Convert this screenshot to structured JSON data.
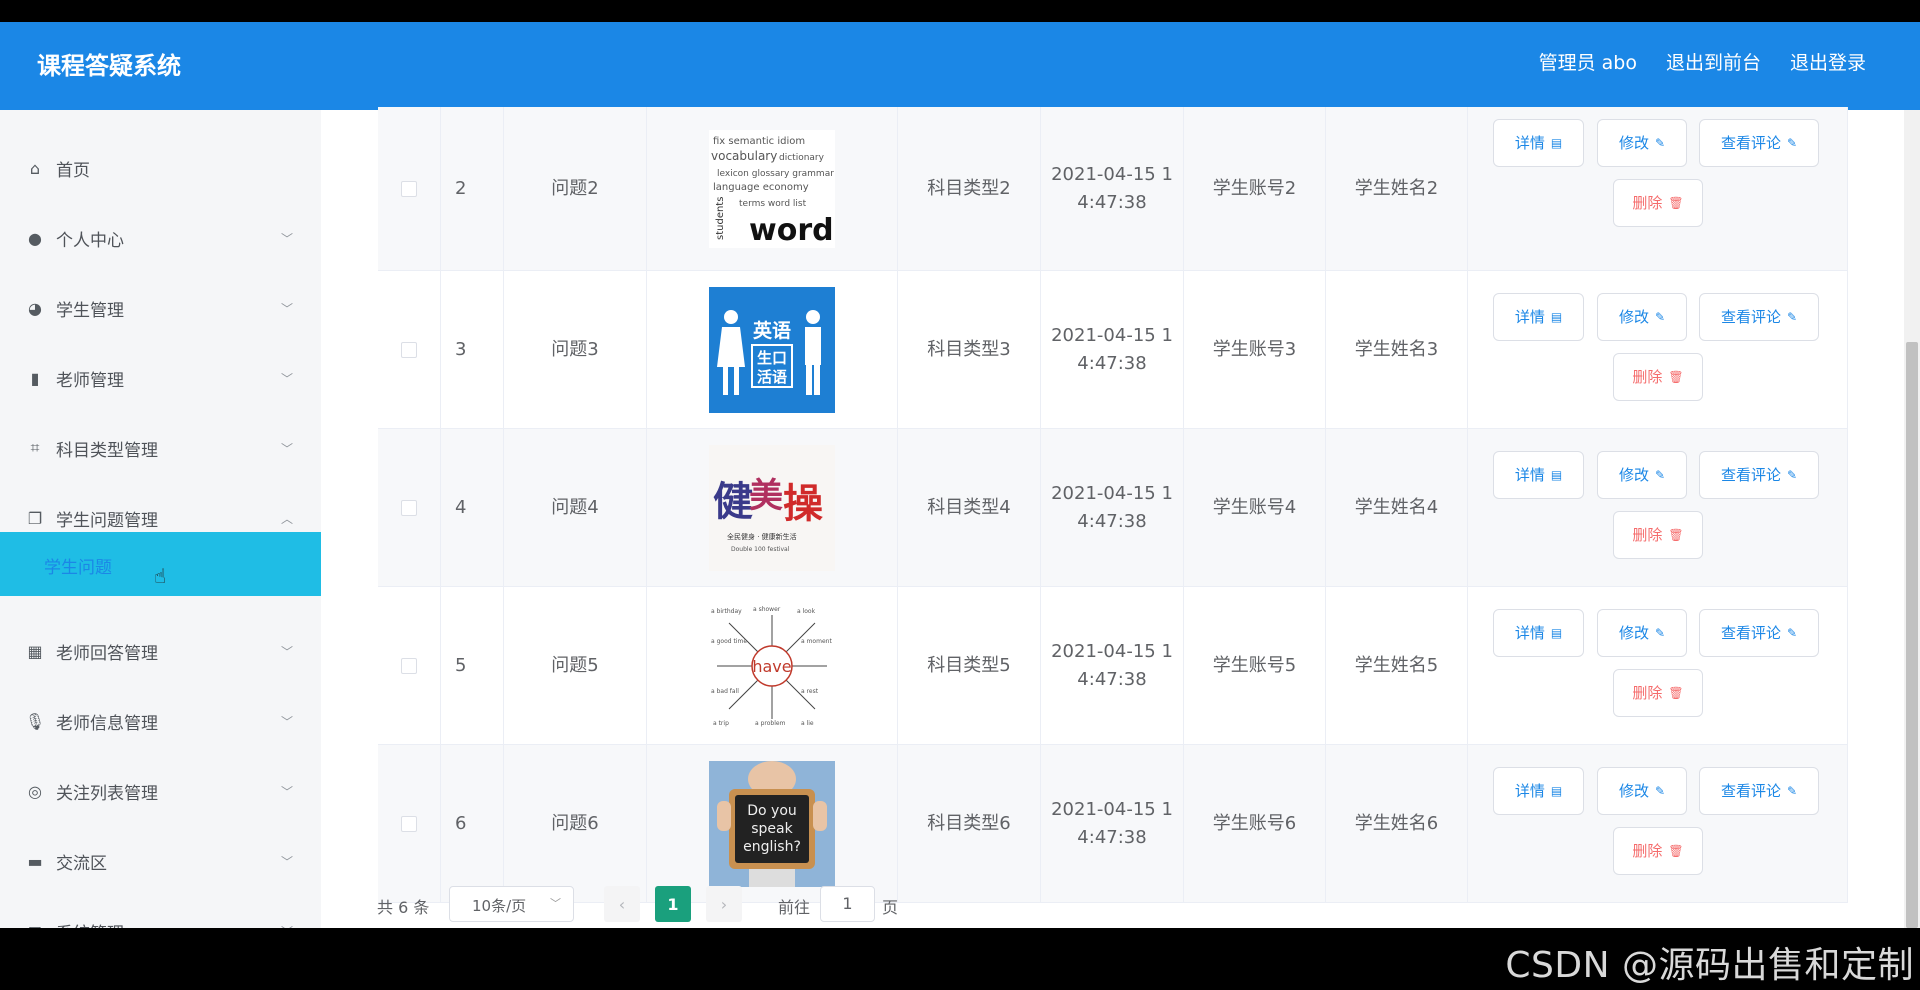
{
  "header": {
    "title": "课程答疑系统",
    "nav": [
      "管理员 abo",
      "退出到前台",
      "退出登录"
    ]
  },
  "sidebar": {
    "items": [
      {
        "label": "首页",
        "icon": "home-icon",
        "chev": ""
      },
      {
        "label": "个人中心",
        "icon": "user-icon",
        "chev": "﹀"
      },
      {
        "label": "学生管理",
        "icon": "bulb-icon",
        "chev": "﹀"
      },
      {
        "label": "老师管理",
        "icon": "book-icon",
        "chev": "﹀"
      },
      {
        "label": "科目类型管理",
        "icon": "crop-icon",
        "chev": "﹀"
      },
      {
        "label": "学生问题管理",
        "icon": "copy-icon",
        "chev": "︿"
      },
      {
        "label": "老师回答管理",
        "icon": "grid-icon",
        "chev": "﹀"
      },
      {
        "label": "老师信息管理",
        "icon": "mic-icon",
        "chev": "﹀"
      },
      {
        "label": "关注列表管理",
        "icon": "lifebuoy-icon",
        "chev": "﹀"
      },
      {
        "label": "交流区",
        "icon": "briefcase-icon",
        "chev": "﹀"
      },
      {
        "label": "系统管理",
        "icon": "mail-icon",
        "chev": "﹀"
      }
    ],
    "active_submenu": "学生问题"
  },
  "table": {
    "rows": [
      {
        "index": "2",
        "title": "问题2",
        "subject": "科目类型2",
        "time_line1": "2021-04-15 1",
        "time_line2": "4:47:38",
        "account": "学生账号2",
        "name": "学生姓名2",
        "image": "vocabulary words"
      },
      {
        "index": "3",
        "title": "问题3",
        "subject": "科目类型3",
        "time_line1": "2021-04-15 1",
        "time_line2": "4:47:38",
        "account": "学生账号3",
        "name": "学生姓名3",
        "image": "英语生口活语"
      },
      {
        "index": "4",
        "title": "问题4",
        "subject": "科目类型4",
        "time_line1": "2021-04-15 1",
        "time_line2": "4:47:38",
        "account": "学生账号4",
        "name": "学生姓名4",
        "image": "健美操"
      },
      {
        "index": "5",
        "title": "问题5",
        "subject": "科目类型5",
        "time_line1": "2021-04-15 1",
        "time_line2": "4:47:38",
        "account": "学生账号5",
        "name": "学生姓名5",
        "image": "have"
      },
      {
        "index": "6",
        "title": "问题6",
        "subject": "科目类型6",
        "time_line1": "2021-04-15 1",
        "time_line2": "4:47:38",
        "account": "学生账号6",
        "name": "学生姓名6",
        "image": "Do you speak english?"
      }
    ],
    "actions": {
      "detail": "详情",
      "edit": "修改",
      "comments": "查看评论",
      "delete": "删除"
    }
  },
  "pagination": {
    "total": "共 6 条",
    "page_size": "10条/页",
    "current_page": "1",
    "goto_label": "前往",
    "goto_value": "1",
    "page_unit": "页"
  },
  "watermark": "CSDN @源码出售和定制",
  "colors": {
    "header": "#1b87e6",
    "active_submenu": "#1fbde5",
    "current_page": "#1aa07d",
    "danger": "#f56c6c"
  }
}
